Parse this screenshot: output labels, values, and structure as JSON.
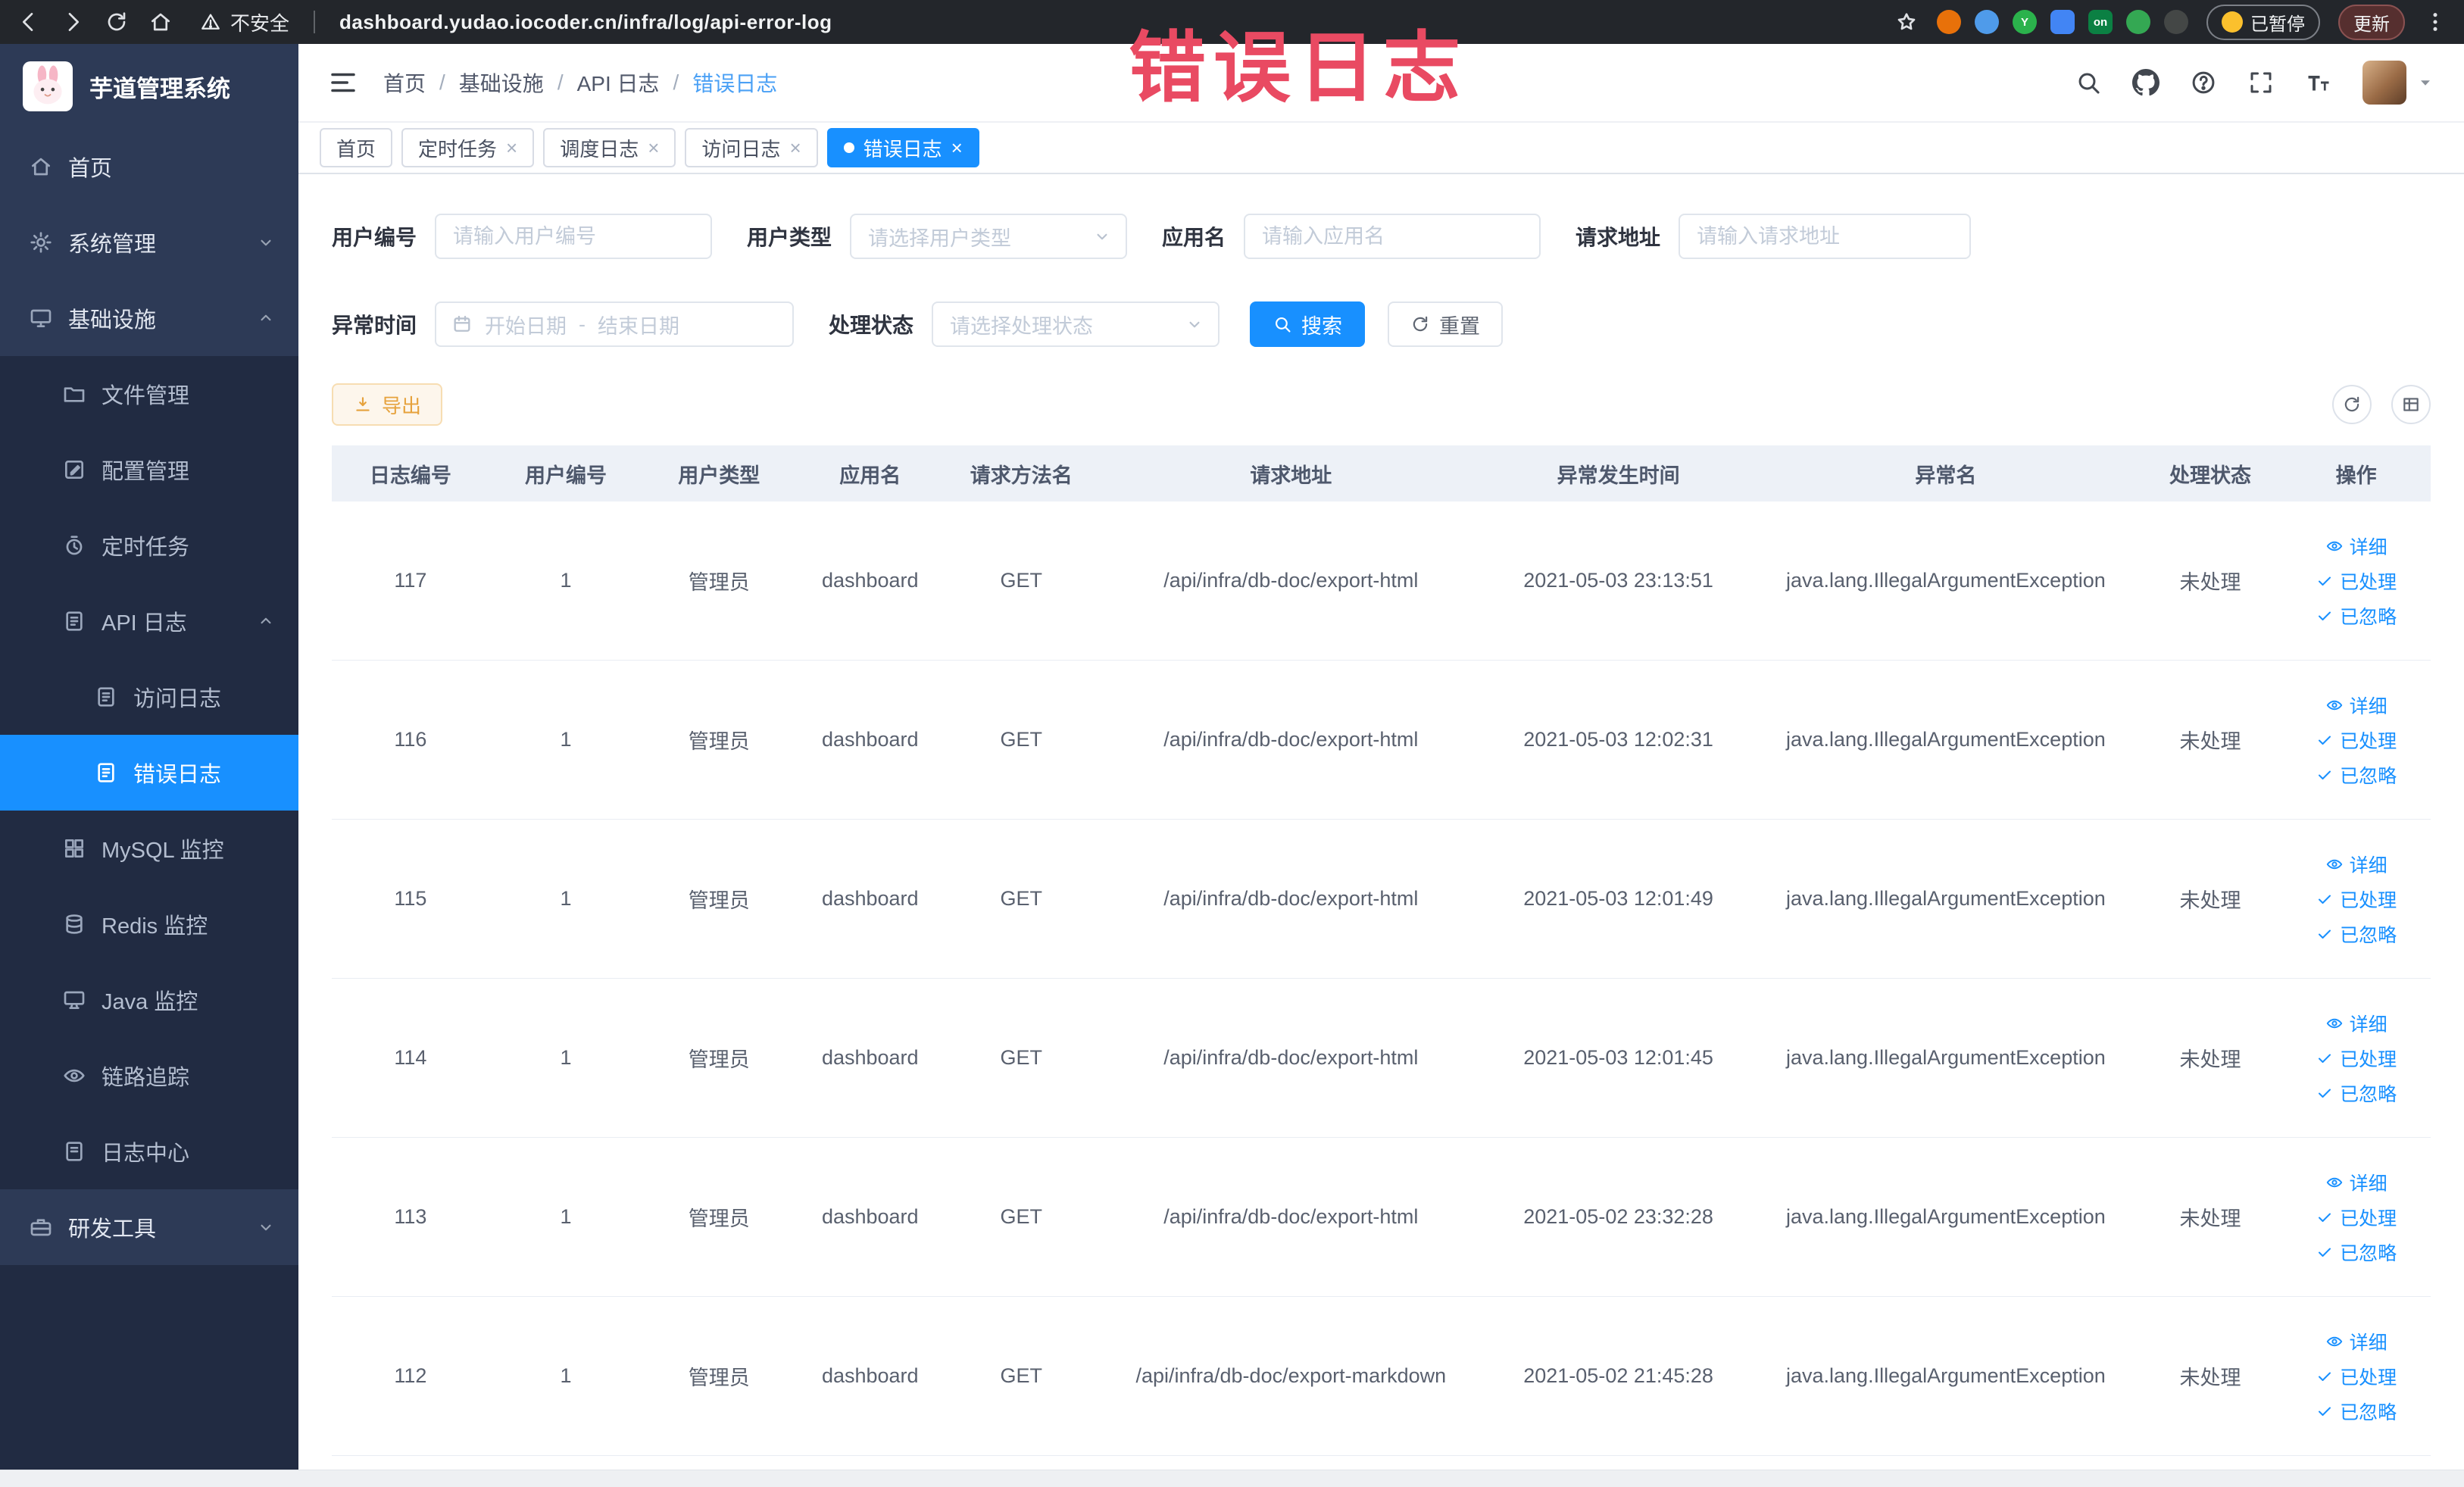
{
  "theme": {
    "primary": "#1890ff",
    "warning": "#e6a23c",
    "annotation_color": "#e94a62",
    "sidebar_bg": "#2d3a56",
    "sidebar_submenu_bg": "#212b42"
  },
  "browser": {
    "security_label": "不安全",
    "url": "dashboard.yudao.iocoder.cn/infra/log/api-error-log",
    "paused_label": "已暂停",
    "update_label": "更新",
    "extensions": [
      {
        "name": "extension-icon",
        "color": "#e8710a",
        "shape": "circle",
        "text": ""
      },
      {
        "name": "extension-icon",
        "color": "#4f9bea",
        "shape": "circle",
        "text": ""
      },
      {
        "name": "extension-icon",
        "color": "#2bb24c",
        "shape": "circle",
        "text": "Y"
      },
      {
        "name": "extension-icon",
        "color": "#4285f4",
        "shape": "square",
        "text": ""
      },
      {
        "name": "extension-icon",
        "color": "#0b8043",
        "shape": "square",
        "text": "on"
      },
      {
        "name": "extension-icon",
        "color": "#34a853",
        "shape": "circle",
        "text": ""
      },
      {
        "name": "extension-icon",
        "color": "#444746",
        "shape": "circle",
        "text": ""
      }
    ]
  },
  "annotation": {
    "text": "错误日志"
  },
  "sidebar": {
    "logo_title": "芋道管理系统",
    "items": [
      {
        "label": "首页",
        "icon": "home-icon",
        "level": 1
      },
      {
        "label": "系统管理",
        "icon": "gear-icon",
        "level": 1,
        "chevron": "down"
      },
      {
        "label": "基础设施",
        "icon": "monitor-icon",
        "level": 1,
        "chevron": "up"
      },
      {
        "label": "文件管理",
        "icon": "folder-icon",
        "level": 2
      },
      {
        "label": "配置管理",
        "icon": "edit-icon",
        "level": 2
      },
      {
        "label": "定时任务",
        "icon": "timer-icon",
        "level": 2
      },
      {
        "label": "API 日志",
        "icon": "doc-edit-icon",
        "level": 2,
        "chevron": "up"
      },
      {
        "label": "访问日志",
        "icon": "doc-edit-icon",
        "level": 3
      },
      {
        "label": "错误日志",
        "icon": "doc-edit-icon",
        "level": 3,
        "active": true
      },
      {
        "label": "MySQL 监控",
        "icon": "grid-icon",
        "level": 2
      },
      {
        "label": "Redis 监控",
        "icon": "layers-icon",
        "level": 2
      },
      {
        "label": "Java 监控",
        "icon": "display-icon",
        "level": 2
      },
      {
        "label": "链路追踪",
        "icon": "eye-icon",
        "level": 2
      },
      {
        "label": "日志中心",
        "icon": "doc-icon",
        "level": 2
      },
      {
        "label": "研发工具",
        "icon": "toolbox-icon",
        "level": 1,
        "chevron": "down"
      }
    ]
  },
  "header": {
    "breadcrumb": [
      {
        "label": "首页"
      },
      {
        "label": "基础设施"
      },
      {
        "label": "API 日志"
      },
      {
        "label": "错误日志",
        "current": true
      }
    ]
  },
  "tabs": [
    {
      "label": "首页",
      "closable": false,
      "active": false
    },
    {
      "label": "定时任务",
      "closable": true,
      "active": false
    },
    {
      "label": "调度日志",
      "closable": true,
      "active": false
    },
    {
      "label": "访问日志",
      "closable": true,
      "active": false
    },
    {
      "label": "错误日志",
      "closable": true,
      "active": true
    }
  ],
  "filters": {
    "fields": [
      {
        "label": "用户编号",
        "placeholder": "请输入用户编号"
      },
      {
        "label": "用户类型",
        "placeholder": "请选择用户类型"
      },
      {
        "label": "应用名",
        "placeholder": "请输入应用名"
      },
      {
        "label": "请求地址",
        "placeholder": "请输入请求地址"
      },
      {
        "label": "异常时间",
        "start_placeholder": "开始日期",
        "separator": "-",
        "end_placeholder": "结束日期"
      },
      {
        "label": "处理状态",
        "placeholder": "请选择处理状态"
      }
    ],
    "search_label": "搜索",
    "reset_label": "重置"
  },
  "toolbar": {
    "export_label": "导出"
  },
  "table": {
    "columns": [
      {
        "label": "日志编号",
        "width": 7.5
      },
      {
        "label": "用户编号",
        "width": 7.3
      },
      {
        "label": "用户类型",
        "width": 7.3
      },
      {
        "label": "应用名",
        "width": 7.1
      },
      {
        "label": "请求方法名",
        "width": 7.3
      },
      {
        "label": "请求地址",
        "width": 18.4
      },
      {
        "label": "异常发生时间",
        "width": 12.8
      },
      {
        "label": "异常名",
        "width": 18.4
      },
      {
        "label": "处理状态",
        "width": 6.8
      },
      {
        "label": "操作",
        "width": 7.1
      }
    ],
    "row_actions": [
      {
        "name": "detail",
        "icon": "eye-icon",
        "label": "详细"
      },
      {
        "name": "processed",
        "icon": "check-icon",
        "label": "已处理"
      },
      {
        "name": "ignored",
        "icon": "check-icon",
        "label": "已忽略"
      }
    ],
    "rows": [
      [
        "117",
        "1",
        "管理员",
        "dashboard",
        "GET",
        "/api/infra/db-doc/export-html",
        "2021-05-03 23:13:51",
        "java.lang.IllegalArgumentException",
        "未处理"
      ],
      [
        "116",
        "1",
        "管理员",
        "dashboard",
        "GET",
        "/api/infra/db-doc/export-html",
        "2021-05-03 12:02:31",
        "java.lang.IllegalArgumentException",
        "未处理"
      ],
      [
        "115",
        "1",
        "管理员",
        "dashboard",
        "GET",
        "/api/infra/db-doc/export-html",
        "2021-05-03 12:01:49",
        "java.lang.IllegalArgumentException",
        "未处理"
      ],
      [
        "114",
        "1",
        "管理员",
        "dashboard",
        "GET",
        "/api/infra/db-doc/export-html",
        "2021-05-03 12:01:45",
        "java.lang.IllegalArgumentException",
        "未处理"
      ],
      [
        "113",
        "1",
        "管理员",
        "dashboard",
        "GET",
        "/api/infra/db-doc/export-html",
        "2021-05-02 23:32:28",
        "java.lang.IllegalArgumentException",
        "未处理"
      ],
      [
        "112",
        "1",
        "管理员",
        "dashboard",
        "GET",
        "/api/infra/db-doc/export-markdown",
        "2021-05-02 21:45:28",
        "java.lang.IllegalArgumentException",
        "未处理"
      ]
    ]
  }
}
